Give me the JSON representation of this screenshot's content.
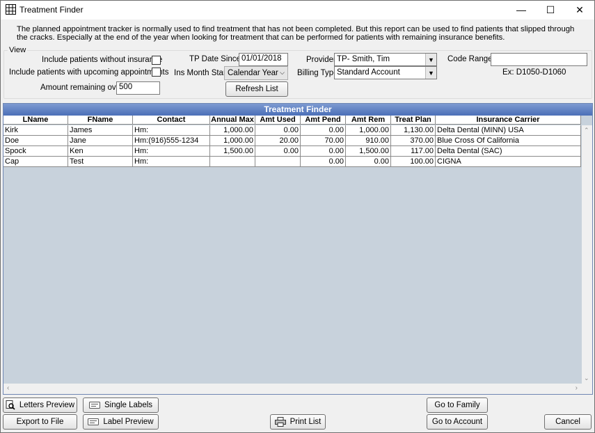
{
  "window": {
    "title": "Treatment Finder",
    "minimize_glyph": "—",
    "maximize_glyph": "☐",
    "close_glyph": "✕",
    "icon": "grid-icon"
  },
  "description": "The planned appointment tracker is normally used to find treatment that has not been completed.  But this report can be used to find patients that slipped through the cracks.  Especially at the end of the year when looking for treatment that can be performed for patients with remaining insurance benefits.",
  "view": {
    "legend": "View",
    "include_without_insurance": {
      "label": "Include patients without insurance",
      "checked": false
    },
    "include_upcoming": {
      "label": "Include patients with upcoming appointments",
      "checked": false
    },
    "amount_remaining": {
      "label": "Amount remaining over",
      "value": "500"
    },
    "tp_date_since": {
      "label": "TP Date Since",
      "value": "01/01/2018"
    },
    "ins_month_start": {
      "label": "Ins Month Start",
      "value": "Calendar Year"
    },
    "refresh_label": "Refresh List",
    "provider": {
      "label": "Provider",
      "value": "TP- Smith, Tim"
    },
    "billing_type": {
      "label": "Billing Type",
      "value": "Standard Account"
    },
    "code_range": {
      "label": "Code Range",
      "value": "",
      "example": "Ex: D1050-D1060"
    }
  },
  "grid": {
    "title": "Treatment Finder",
    "columns": [
      "LName",
      "FName",
      "Contact",
      "Annual Max",
      "Amt Used",
      "Amt Pend",
      "Amt Rem",
      "Treat Plan",
      "Insurance Carrier"
    ],
    "rows": [
      [
        "Kirk",
        "James",
        "Hm:",
        "1,000.00",
        "0.00",
        "0.00",
        "1,000.00",
        "1,130.00",
        "Delta Dental (MINN) USA"
      ],
      [
        "Doe",
        "Jane",
        "Hm:(916)555-1234",
        "1,000.00",
        "20.00",
        "70.00",
        "910.00",
        "370.00",
        "Blue Cross Of California"
      ],
      [
        "Spock",
        "Ken",
        "Hm:",
        "1,500.00",
        "0.00",
        "0.00",
        "1,500.00",
        "117.00",
        "Delta Dental (SAC)"
      ],
      [
        "Cap",
        "Test",
        "Hm:",
        "",
        "",
        "0.00",
        "0.00",
        "100.00",
        "CIGNA"
      ]
    ]
  },
  "buttons": {
    "letters_preview": "Letters Preview",
    "single_labels": "Single Labels",
    "export_to_file": "Export to File",
    "label_preview": "Label Preview",
    "print_list": "Print List",
    "go_to_family": "Go to Family",
    "go_to_account": "Go to Account",
    "cancel": "Cancel"
  }
}
